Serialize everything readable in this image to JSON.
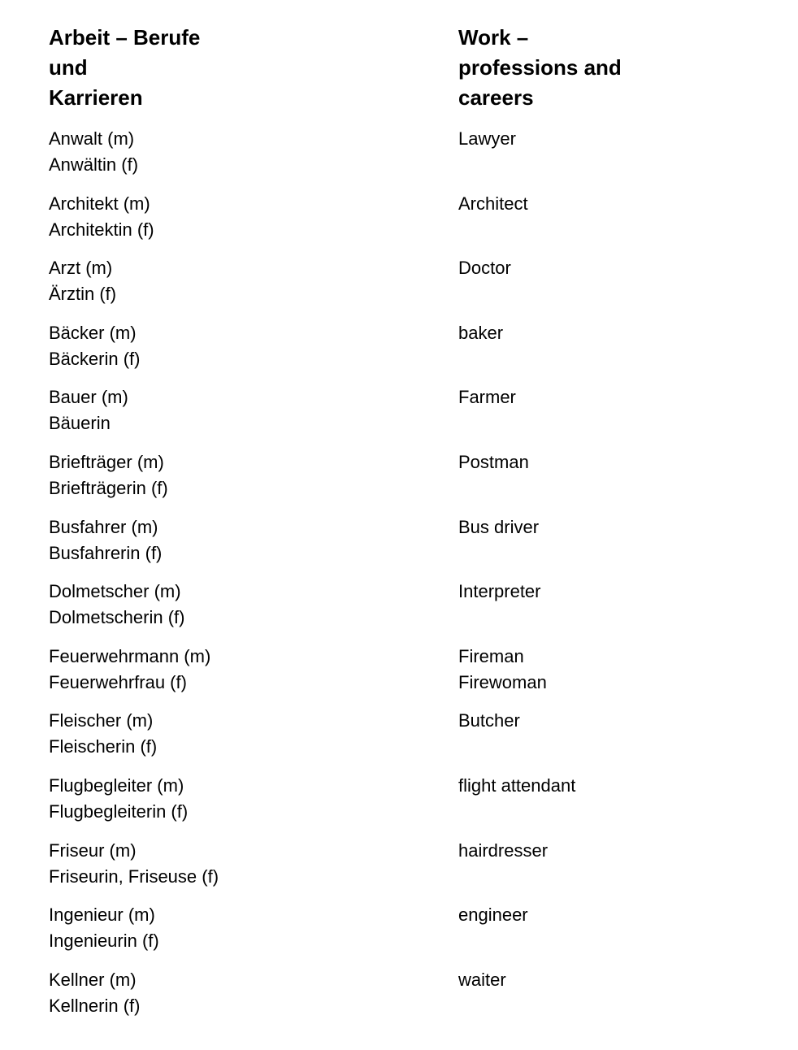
{
  "german": {
    "heading": [
      "Arbeit – Berufe",
      "und",
      "Karrieren"
    ],
    "entries": [
      [
        "Anwalt (m)",
        "Anwältin (f)"
      ],
      [
        "Architekt (m)",
        "Architektin (f)"
      ],
      [
        "Arzt (m)",
        "Ärztin (f)"
      ],
      [
        "Bäcker (m)",
        "Bäckerin (f)"
      ],
      [
        "Bauer (m)",
        "Bäuerin"
      ],
      [
        "Briefträger (m)",
        "Briefträgerin (f)"
      ],
      [
        "Busfahrer (m)",
        "Busfahrerin (f)"
      ],
      [
        "Dolmetscher (m)",
        "Dolmetscherin (f)"
      ],
      [
        "Feuerwehrmann (m)",
        "Feuerwehrfrau (f)"
      ],
      [
        "Fleischer (m)",
        "Fleischerin (f)"
      ],
      [
        "Flugbegleiter (m)",
        "Flugbegleiterin (f)"
      ],
      [
        "Friseur (m)",
        "Friseurin, Friseuse (f)"
      ],
      [
        "Ingenieur (m)",
        "Ingenieurin (f)"
      ],
      [
        "Kellner (m)",
        "Kellnerin (f)"
      ]
    ]
  },
  "english": {
    "heading": [
      "Work –",
      "professions and",
      "careers"
    ],
    "entries": [
      [
        "Lawyer"
      ],
      [
        "Architect"
      ],
      [
        "Doctor"
      ],
      [
        "baker"
      ],
      [
        "Farmer"
      ],
      [
        "Postman"
      ],
      [
        "Bus driver"
      ],
      [
        "Interpreter"
      ],
      [
        "Fireman",
        "Firewoman"
      ],
      [
        "Butcher"
      ],
      [
        "flight attendant"
      ],
      [
        "hairdresser"
      ],
      [
        "engineer"
      ],
      [
        "waiter"
      ]
    ]
  }
}
